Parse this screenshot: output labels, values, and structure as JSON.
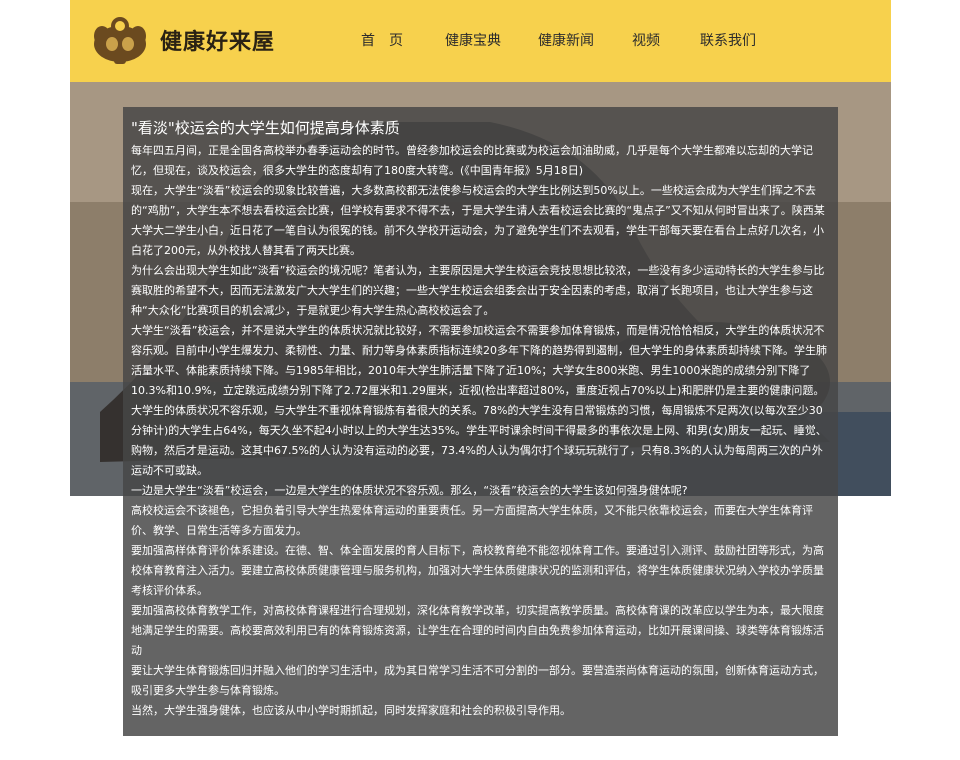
{
  "header": {
    "site_name": "健康好来屋",
    "nav": [
      "首　页",
      "健康宝典",
      "健康新闻",
      "视频",
      "联系我们"
    ]
  },
  "colors": {
    "header_bg": "#f7d14d",
    "article_bg": "#464646",
    "text": "#ffffff"
  },
  "icons": {
    "logo": "muscle-man-icon"
  },
  "article": {
    "title": "\"看淡\"校运会的大学生如何提高身体素质",
    "paragraphs": [
      "每年四五月间，正是全国各高校举办春季运动会的时节。曾经参加校运会的比赛或为校运会加油助威，几乎是每个大学生都难以忘却的大学记忆，但现在，谈及校运会，很多大学生的态度却有了180度大转弯。(《中国青年报》5月18日)",
      "现在，大学生“淡看”校运会的现象比较普遍，大多数高校都无法使参与校运会的大学生比例达到50%以上。一些校运会成为大学生们挥之不去的“鸡肋”，大学生本不想去看校运会比赛，但学校有要求不得不去，于是大学生请人去看校运会比赛的“鬼点子”又不知从何时冒出来了。陕西某大学大二学生小白，近日花了一笔自认为很冤的钱。前不久学校开运动会，为了避免学生们不去观看，学生干部每天要在看台上点好几次名，小白花了200元，从外校找人替其看了两天比赛。",
      "为什么会出现大学生如此“淡看”校运会的境况呢？笔者认为，主要原因是大学生校运会竞技思想比较浓，一些没有多少运动特长的大学生参与比赛取胜的希望不大，因而无法激发广大大学生们的兴趣；一些大学生校运会组委会出于安全因素的考虑，取消了长跑项目，也让大学生参与这种“大众化”比赛项目的机会减少，于是就更少有大学生热心高校校运会了。",
      "大学生“淡看”校运会，并不是说大学生的体质状况就比较好，不需要参加校运会不需要参加体育锻炼，而是情况恰恰相反，大学生的体质状况不容乐观。目前中小学生爆发力、柔韧性、力量、耐力等身体素质指标连续20多年下降的趋势得到遏制，但大学生的身体素质却持续下降。学生肺活量水平、体能素质持续下降。与1985年相比，2010年大学生肺活量下降了近10%；大学女生800米跑、男生1000米跑的成绩分别下降了10.3%和10.9%，立定跳远成绩分别下降了2.72厘米和1.29厘米，近视(检出率超过80%，重度近视占70%以上)和肥胖仍是主要的健康问题。",
      "大学生的体质状况不容乐观，与大学生不重视体育锻炼有着很大的关系。78%的大学生没有日常锻炼的习惯，每周锻炼不足两次(以每次至少30分钟计)的大学生占64%，每天久坐不起4小时以上的大学生达35%。学生平时课余时间干得最多的事依次是上网、和男(女)朋友一起玩、睡觉、购物，然后才是运动。这其中67.5%的人认为没有运动的必要，73.4%的人认为偶尔打个球玩玩就行了，只有8.3%的人认为每周两三次的户外运动不可或缺。",
      "一边是大学生“淡看”校运会，一边是大学生的体质状况不容乐观。那么，“淡看”校运会的大学生该如何强身健体呢?",
      "高校校运会不该褪色，它担负着引导大学生热爱体育运动的重要责任。另一方面提高大学生体质，又不能只依靠校运会，而要在大学生体育评价、教学、日常生活等多方面发力。",
      "要加强高样体育评价体系建设。在德、智、体全面发展的育人目标下，高校教育绝不能忽视体育工作。要通过引入测评、鼓励社团等形式，为高校体育教育注入活力。要建立高校体质健康管理与服务机构，加强对大学生体质健康状况的监测和评估，将学生体质健康状况纳入学校办学质量考核评价体系。",
      "要加强高校体育教学工作，对高校体育课程进行合理规划，深化体育教学改革，切实提高教学质量。高校体育课的改革应以学生为本，最大限度地满足学生的需要。高校要高效利用已有的体育锻炼资源，让学生在合理的时间内自由免费参加体育运动，比如开展课间操、球类等体育锻炼活动",
      "要让大学生体育锻炼回归并融入他们的学习生活中，成为其日常学习生活不可分割的一部分。要营造崇尚体育运动的氛围，创新体育运动方式，吸引更多大学生参与体育锻炼。",
      "当然，大学生强身健体，也应该从中小学时期抓起，同时发挥家庭和社会的积极引导作用。"
    ]
  }
}
